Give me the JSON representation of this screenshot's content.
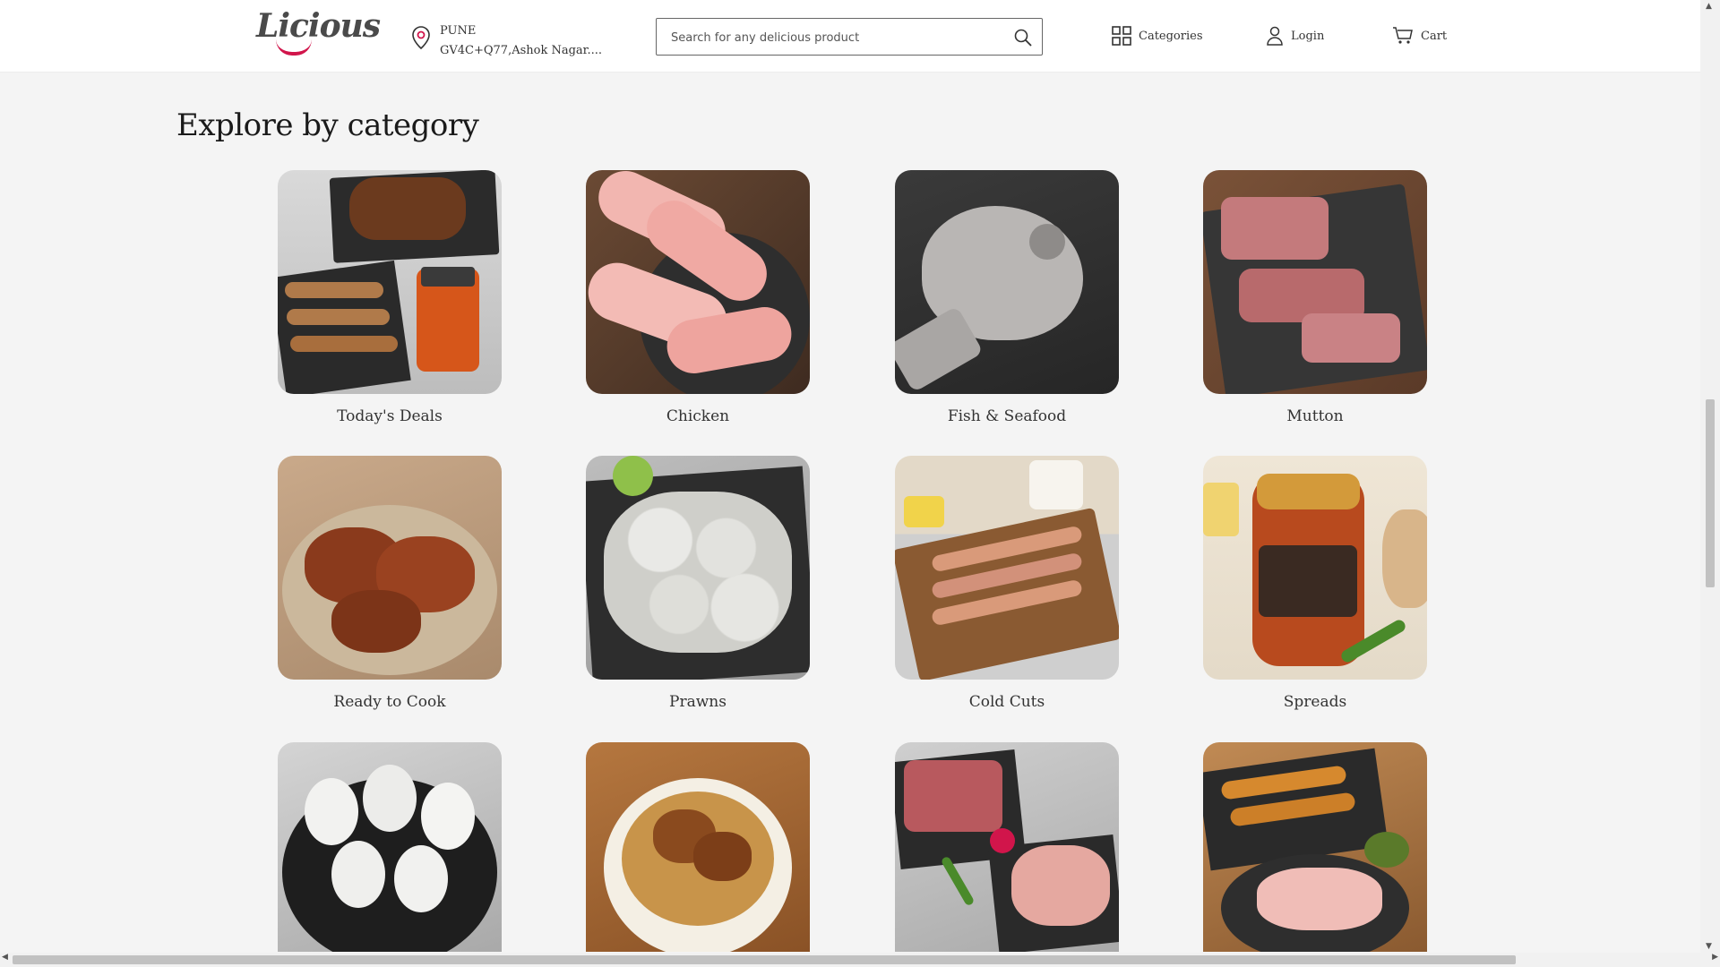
{
  "header": {
    "logo_text": "Licious",
    "location_city": "PUNE",
    "location_address": "GV4C+Q77,Ashok Nagar....",
    "search_placeholder": "Search for any delicious product",
    "nav": {
      "categories": "Categories",
      "login": "Login",
      "cart": "Cart"
    }
  },
  "section": {
    "title": "Explore by category"
  },
  "categories": [
    {
      "label": "Today's Deals"
    },
    {
      "label": "Chicken"
    },
    {
      "label": "Fish & Seafood"
    },
    {
      "label": "Mutton"
    },
    {
      "label": "Ready to Cook"
    },
    {
      "label": "Prawns"
    },
    {
      "label": "Cold Cuts"
    },
    {
      "label": "Spreads"
    },
    {
      "label": ""
    },
    {
      "label": ""
    },
    {
      "label": ""
    },
    {
      "label": ""
    }
  ],
  "colors": {
    "brand": "#d1154b",
    "page_bg": "#f4f4f4",
    "header_bg": "#ffffff"
  }
}
